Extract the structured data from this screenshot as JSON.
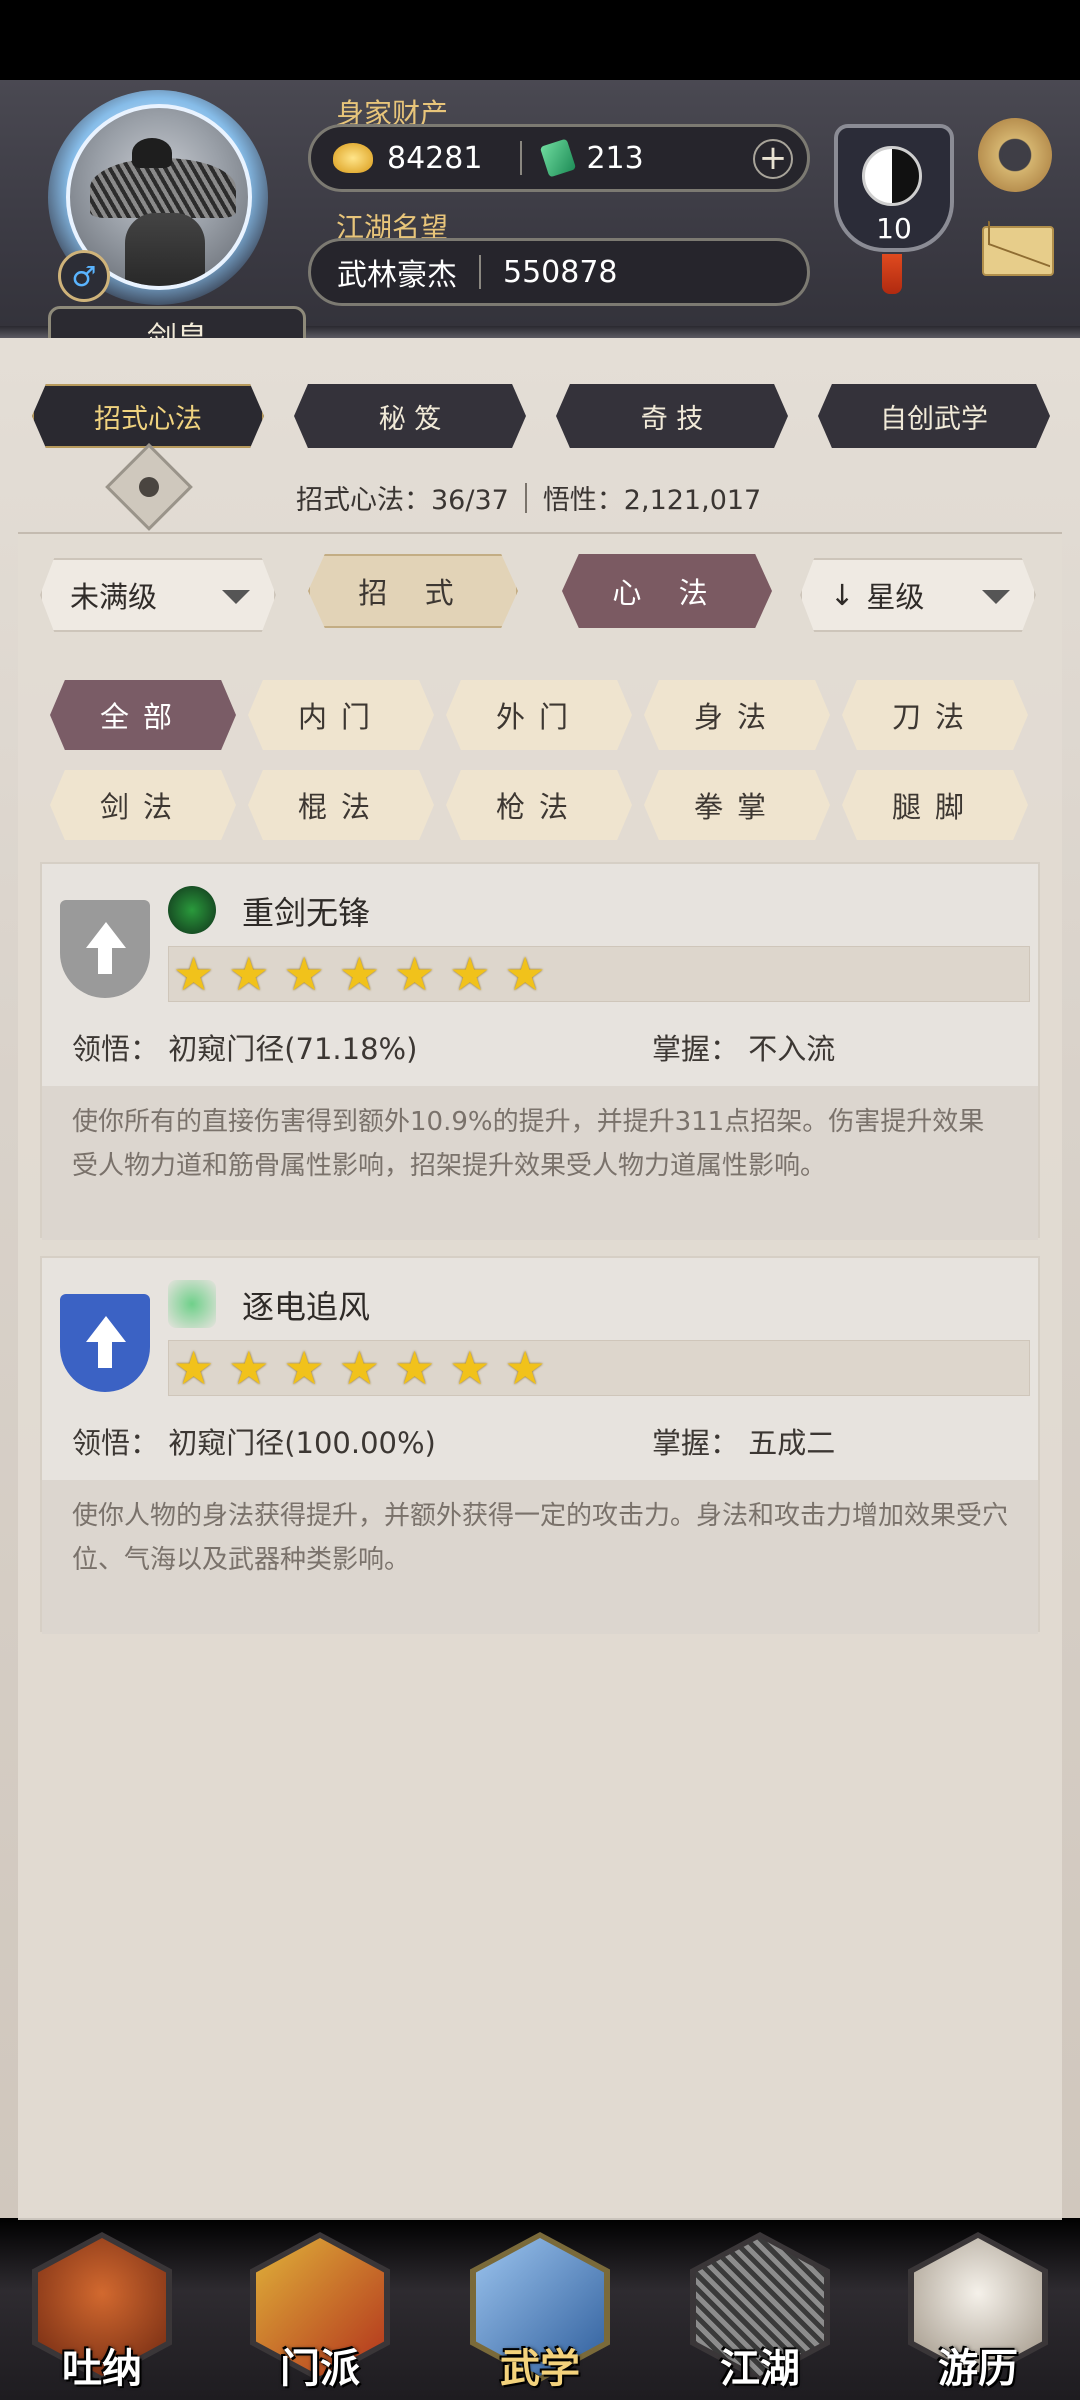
{
  "header": {
    "player_title": "剑皇",
    "gender_symbol": "♂",
    "wealth_label": "身家财产",
    "gold": "84281",
    "jade": "213",
    "plus_symbol": "+",
    "reputation_label": "江湖名望",
    "rep_title": "武林豪杰",
    "rep_value": "550878",
    "taiji_level": "10"
  },
  "top_tabs": [
    {
      "label": "招式心法",
      "active": true
    },
    {
      "label": "秘 笈",
      "active": false
    },
    {
      "label": "奇 技",
      "active": false
    },
    {
      "label": "自创武学",
      "active": false
    }
  ],
  "progress": {
    "moves_text": "招式心法：36/37",
    "insight_text": "悟性：2,121,017"
  },
  "filters": {
    "level_filter": "未满级",
    "seg_moves": "招 式",
    "seg_methods": "心 法",
    "sort_arrow": "↓",
    "sort_label": "星级"
  },
  "chips": [
    {
      "label": "全部",
      "active": true
    },
    {
      "label": "内门",
      "active": false
    },
    {
      "label": "外门",
      "active": false
    },
    {
      "label": "身法",
      "active": false
    },
    {
      "label": "刀法",
      "active": false
    },
    {
      "label": "剑法",
      "active": false
    },
    {
      "label": "棍法",
      "active": false
    },
    {
      "label": "枪法",
      "active": false
    },
    {
      "label": "拳掌",
      "active": false
    },
    {
      "label": "腿脚",
      "active": false
    }
  ],
  "skills": [
    {
      "name": "重剑无锋",
      "stars": 7,
      "comprehension": "领悟：  初窥门径(71.18%)",
      "mastery": "掌握：  不入流",
      "description": "使你所有的直接伤害得到额外10.9%的提升，并提升311点招架。伤害提升效果受人物力道和筋骨属性影响，招架提升效果受人物力道属性影响。",
      "badge_color": "#9a9a9a",
      "icon_color": "#2a9a3c"
    },
    {
      "name": "逐电追风",
      "stars": 7,
      "comprehension": "领悟：  初窥门径(100.00%)",
      "mastery": "掌握：  五成二",
      "description": "使你人物的身法获得提升，并额外获得一定的攻击力。身法和攻击力增加效果受穴位、气海以及武器种类影响。",
      "badge_color": "#3b62c4",
      "icon_color": "#3fae5a"
    }
  ],
  "bottom_nav": [
    {
      "label": "吐纳",
      "active": false,
      "color": "#9b3a1c"
    },
    {
      "label": "门派",
      "active": false,
      "color": "#c9962a"
    },
    {
      "label": "武学",
      "active": true,
      "color": "#4f7fb8"
    },
    {
      "label": "江湖",
      "active": false,
      "color": "#5a5a5a"
    },
    {
      "label": "游历",
      "active": false,
      "color": "#d9d2c6"
    }
  ]
}
